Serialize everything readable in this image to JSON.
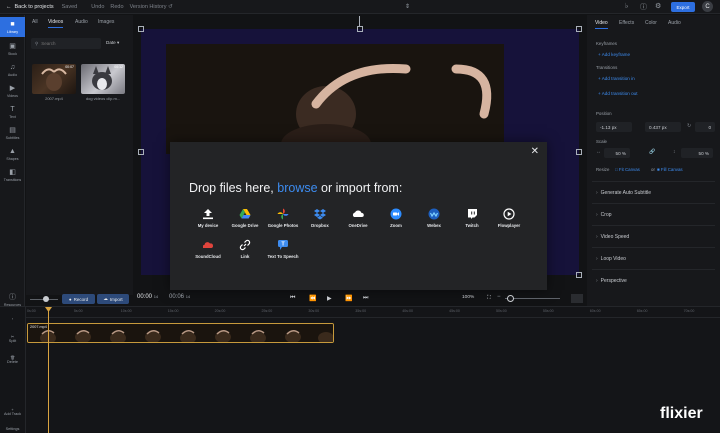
{
  "topbar": {
    "back_label": "Back to projects",
    "saved_label": "Saved",
    "undo_label": "Undo",
    "redo_label": "Redo",
    "version_history_label": "Version History",
    "export_label": "Export",
    "avatar_initial": "C"
  },
  "rail": {
    "items": [
      {
        "label": "Library",
        "icon": "folder-icon"
      },
      {
        "label": "Stock",
        "icon": "film-icon"
      },
      {
        "label": "Audio",
        "icon": "music-icon"
      },
      {
        "label": "Videos",
        "icon": "video-icon"
      },
      {
        "label": "Text",
        "icon": "text-icon"
      },
      {
        "label": "Subtitles",
        "icon": "subtitles-icon"
      },
      {
        "label": "Shapes",
        "icon": "shapes-icon"
      },
      {
        "label": "Transitions",
        "icon": "transitions-icon"
      },
      {
        "label": "Resources",
        "icon": "help-icon"
      }
    ]
  },
  "library": {
    "tabs": [
      "All",
      "Videos",
      "Audio",
      "Images"
    ],
    "active_tab": "Videos",
    "search_placeholder": "Search",
    "sort_label": "Date",
    "items": [
      {
        "name": "2007.mp4",
        "duration": "00:07"
      },
      {
        "name": "dog videos clip.m...",
        "duration": "00:12"
      }
    ],
    "record_label": "Record",
    "import_label": "Import"
  },
  "modal": {
    "title_pre": "Drop files here,",
    "title_link": "browse",
    "title_post": "or import from:",
    "sources_row1": [
      {
        "label": "My device",
        "icon": "upload-icon",
        "color": "#ffffff"
      },
      {
        "label": "Google Drive",
        "icon": "google-drive-icon",
        "color": "#34a853"
      },
      {
        "label": "Google Photos",
        "icon": "google-photos-icon",
        "color": "#ea4335"
      },
      {
        "label": "Dropbox",
        "icon": "dropbox-icon",
        "color": "#3d8cf0"
      },
      {
        "label": "OneDrive",
        "icon": "onedrive-icon",
        "color": "#ffffff"
      },
      {
        "label": "Zoom",
        "icon": "zoom-icon",
        "color": "#2d8cff"
      },
      {
        "label": "Webex",
        "icon": "webex-icon",
        "color": "#3d8cf0"
      },
      {
        "label": "Twitch",
        "icon": "twitch-icon",
        "color": "#ffffff"
      },
      {
        "label": "Flowplayer",
        "icon": "flowplayer-icon",
        "color": "#ffffff"
      }
    ],
    "sources_row2": [
      {
        "label": "SoundCloud",
        "icon": "soundcloud-icon",
        "color": "#e0443c"
      },
      {
        "label": "Link",
        "icon": "link-icon",
        "color": "#ffffff"
      },
      {
        "label": "Text To Speech",
        "icon": "text-to-speech-icon",
        "color": "#3d8cf0"
      }
    ]
  },
  "player": {
    "current_time": "00:00",
    "current_frames": "14",
    "total_time": "00:06",
    "total_frames": "14",
    "zoom": "100%"
  },
  "right_panel": {
    "tabs": [
      "Video",
      "Effects",
      "Color",
      "Audio"
    ],
    "active_tab": "Video",
    "keyframes_label": "Keyframes",
    "add_keyframe": "Add keyframe",
    "transitions_label": "Transitions",
    "add_transition_in": "Add transition in",
    "add_transition_out": "Add transition out",
    "position_label": "Position",
    "pos_x": "-1.13 px",
    "pos_y": "0.437 px",
    "rotation": "0",
    "scale_label": "Scale",
    "scale_w": "50 %",
    "scale_h": "50 %",
    "resize_label": "Resize",
    "fit_canvas": "Fit Canvas",
    "or_label": "or",
    "fill_canvas": "Fill Canvas",
    "sections": [
      "Generate Auto Subtitle",
      "Crop",
      "Video Speed",
      "Loop Video",
      "Perspective"
    ]
  },
  "timeline": {
    "ticks": [
      "0s:00",
      "5s:00",
      "10s:00",
      "15s:00",
      "20s:00",
      "25s:00",
      "30s:00",
      "35s:00",
      "40s:00",
      "45s:00",
      "50s:00",
      "55s:00",
      "60s:00",
      "65s:00",
      "70s:00"
    ],
    "clip_name": "2007.mp4",
    "side_labels": [
      "Split",
      "Delete",
      "Add Track",
      "Settings"
    ]
  },
  "branding": {
    "logo_text": "flixier"
  },
  "colors": {
    "accent": "#2d6fe0",
    "link": "#3d8cf0",
    "playhead": "#d9a441"
  }
}
